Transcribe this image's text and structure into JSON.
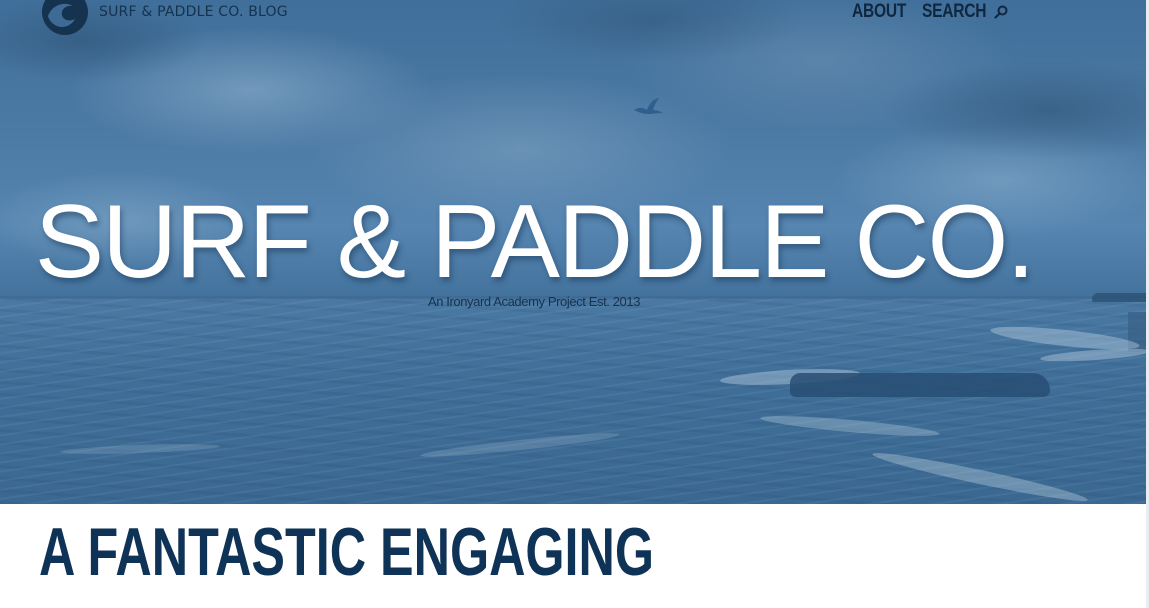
{
  "site": {
    "brand_name": "SURF & PADDLE CO. BLOG",
    "logo_icon": "wave-logo-icon"
  },
  "nav": {
    "items": [
      {
        "label": "ABOUT"
      },
      {
        "label": "SEARCH",
        "icon": "search-icon"
      }
    ]
  },
  "hero": {
    "title": "SURF & PADDLE CO.",
    "subtitle": "An Ironyard Academy Project Est. 2013",
    "overlay_color": "#3a6a96"
  },
  "post": {
    "title": "A FANTASTIC ENGAGING"
  },
  "colors": {
    "brand_dark": "#15324f",
    "title_blue": "#0f3356",
    "hero_text": "#ffffff"
  }
}
